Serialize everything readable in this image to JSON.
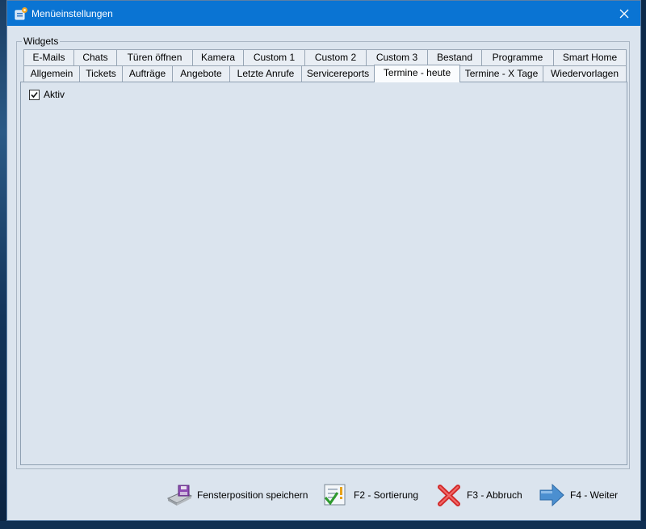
{
  "window": {
    "title": "Menüeinstellungen",
    "titlebar_color": "#0a74d3"
  },
  "groupbox": {
    "label": "Widgets"
  },
  "tabs_row1": [
    {
      "label": "E-Mails"
    },
    {
      "label": "Chats"
    },
    {
      "label": "Türen öffnen"
    },
    {
      "label": "Kamera"
    },
    {
      "label": "Custom 1"
    },
    {
      "label": "Custom 2"
    },
    {
      "label": "Custom 3"
    },
    {
      "label": "Bestand"
    },
    {
      "label": "Programme"
    },
    {
      "label": "Smart Home"
    }
  ],
  "tabs_row2": [
    {
      "label": "Allgemein"
    },
    {
      "label": "Tickets"
    },
    {
      "label": "Aufträge"
    },
    {
      "label": "Angebote"
    },
    {
      "label": "Letzte Anrufe"
    },
    {
      "label": "Servicereports"
    },
    {
      "label": "Termine - heute",
      "active": true
    },
    {
      "label": "Termine - X Tage"
    },
    {
      "label": "Wiedervorlagen"
    }
  ],
  "panel": {
    "checkbox_label": "Aktiv",
    "checkbox_checked": true
  },
  "footer": {
    "save_position": {
      "label": "Fensterposition speichern",
      "icon": "floppy-disk-icon"
    },
    "sort": {
      "label": "F2 - Sortierung",
      "icon": "checklist-icon"
    },
    "cancel": {
      "label": "F3 - Abbruch",
      "icon": "red-x-icon"
    },
    "next": {
      "label": "F4 - Weiter",
      "icon": "arrow-right-icon"
    }
  }
}
